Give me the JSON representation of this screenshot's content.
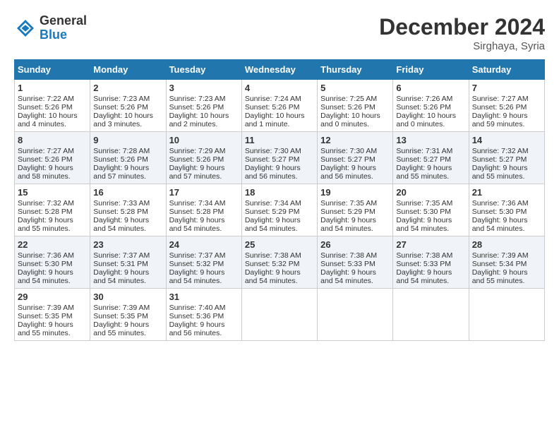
{
  "header": {
    "logo_general": "General",
    "logo_blue": "Blue",
    "month_title": "December 2024",
    "location": "Sirghaya, Syria"
  },
  "weekdays": [
    "Sunday",
    "Monday",
    "Tuesday",
    "Wednesday",
    "Thursday",
    "Friday",
    "Saturday"
  ],
  "weeks": [
    [
      {
        "day": "1",
        "sunrise": "Sunrise: 7:22 AM",
        "sunset": "Sunset: 5:26 PM",
        "daylight": "Daylight: 10 hours and 4 minutes."
      },
      {
        "day": "2",
        "sunrise": "Sunrise: 7:23 AM",
        "sunset": "Sunset: 5:26 PM",
        "daylight": "Daylight: 10 hours and 3 minutes."
      },
      {
        "day": "3",
        "sunrise": "Sunrise: 7:23 AM",
        "sunset": "Sunset: 5:26 PM",
        "daylight": "Daylight: 10 hours and 2 minutes."
      },
      {
        "day": "4",
        "sunrise": "Sunrise: 7:24 AM",
        "sunset": "Sunset: 5:26 PM",
        "daylight": "Daylight: 10 hours and 1 minute."
      },
      {
        "day": "5",
        "sunrise": "Sunrise: 7:25 AM",
        "sunset": "Sunset: 5:26 PM",
        "daylight": "Daylight: 10 hours and 0 minutes."
      },
      {
        "day": "6",
        "sunrise": "Sunrise: 7:26 AM",
        "sunset": "Sunset: 5:26 PM",
        "daylight": "Daylight: 10 hours and 0 minutes."
      },
      {
        "day": "7",
        "sunrise": "Sunrise: 7:27 AM",
        "sunset": "Sunset: 5:26 PM",
        "daylight": "Daylight: 9 hours and 59 minutes."
      }
    ],
    [
      {
        "day": "8",
        "sunrise": "Sunrise: 7:27 AM",
        "sunset": "Sunset: 5:26 PM",
        "daylight": "Daylight: 9 hours and 58 minutes."
      },
      {
        "day": "9",
        "sunrise": "Sunrise: 7:28 AM",
        "sunset": "Sunset: 5:26 PM",
        "daylight": "Daylight: 9 hours and 57 minutes."
      },
      {
        "day": "10",
        "sunrise": "Sunrise: 7:29 AM",
        "sunset": "Sunset: 5:26 PM",
        "daylight": "Daylight: 9 hours and 57 minutes."
      },
      {
        "day": "11",
        "sunrise": "Sunrise: 7:30 AM",
        "sunset": "Sunset: 5:27 PM",
        "daylight": "Daylight: 9 hours and 56 minutes."
      },
      {
        "day": "12",
        "sunrise": "Sunrise: 7:30 AM",
        "sunset": "Sunset: 5:27 PM",
        "daylight": "Daylight: 9 hours and 56 minutes."
      },
      {
        "day": "13",
        "sunrise": "Sunrise: 7:31 AM",
        "sunset": "Sunset: 5:27 PM",
        "daylight": "Daylight: 9 hours and 55 minutes."
      },
      {
        "day": "14",
        "sunrise": "Sunrise: 7:32 AM",
        "sunset": "Sunset: 5:27 PM",
        "daylight": "Daylight: 9 hours and 55 minutes."
      }
    ],
    [
      {
        "day": "15",
        "sunrise": "Sunrise: 7:32 AM",
        "sunset": "Sunset: 5:28 PM",
        "daylight": "Daylight: 9 hours and 55 minutes."
      },
      {
        "day": "16",
        "sunrise": "Sunrise: 7:33 AM",
        "sunset": "Sunset: 5:28 PM",
        "daylight": "Daylight: 9 hours and 54 minutes."
      },
      {
        "day": "17",
        "sunrise": "Sunrise: 7:34 AM",
        "sunset": "Sunset: 5:28 PM",
        "daylight": "Daylight: 9 hours and 54 minutes."
      },
      {
        "day": "18",
        "sunrise": "Sunrise: 7:34 AM",
        "sunset": "Sunset: 5:29 PM",
        "daylight": "Daylight: 9 hours and 54 minutes."
      },
      {
        "day": "19",
        "sunrise": "Sunrise: 7:35 AM",
        "sunset": "Sunset: 5:29 PM",
        "daylight": "Daylight: 9 hours and 54 minutes."
      },
      {
        "day": "20",
        "sunrise": "Sunrise: 7:35 AM",
        "sunset": "Sunset: 5:30 PM",
        "daylight": "Daylight: 9 hours and 54 minutes."
      },
      {
        "day": "21",
        "sunrise": "Sunrise: 7:36 AM",
        "sunset": "Sunset: 5:30 PM",
        "daylight": "Daylight: 9 hours and 54 minutes."
      }
    ],
    [
      {
        "day": "22",
        "sunrise": "Sunrise: 7:36 AM",
        "sunset": "Sunset: 5:30 PM",
        "daylight": "Daylight: 9 hours and 54 minutes."
      },
      {
        "day": "23",
        "sunrise": "Sunrise: 7:37 AM",
        "sunset": "Sunset: 5:31 PM",
        "daylight": "Daylight: 9 hours and 54 minutes."
      },
      {
        "day": "24",
        "sunrise": "Sunrise: 7:37 AM",
        "sunset": "Sunset: 5:32 PM",
        "daylight": "Daylight: 9 hours and 54 minutes."
      },
      {
        "day": "25",
        "sunrise": "Sunrise: 7:38 AM",
        "sunset": "Sunset: 5:32 PM",
        "daylight": "Daylight: 9 hours and 54 minutes."
      },
      {
        "day": "26",
        "sunrise": "Sunrise: 7:38 AM",
        "sunset": "Sunset: 5:33 PM",
        "daylight": "Daylight: 9 hours and 54 minutes."
      },
      {
        "day": "27",
        "sunrise": "Sunrise: 7:38 AM",
        "sunset": "Sunset: 5:33 PM",
        "daylight": "Daylight: 9 hours and 54 minutes."
      },
      {
        "day": "28",
        "sunrise": "Sunrise: 7:39 AM",
        "sunset": "Sunset: 5:34 PM",
        "daylight": "Daylight: 9 hours and 55 minutes."
      }
    ],
    [
      {
        "day": "29",
        "sunrise": "Sunrise: 7:39 AM",
        "sunset": "Sunset: 5:35 PM",
        "daylight": "Daylight: 9 hours and 55 minutes."
      },
      {
        "day": "30",
        "sunrise": "Sunrise: 7:39 AM",
        "sunset": "Sunset: 5:35 PM",
        "daylight": "Daylight: 9 hours and 55 minutes."
      },
      {
        "day": "31",
        "sunrise": "Sunrise: 7:40 AM",
        "sunset": "Sunset: 5:36 PM",
        "daylight": "Daylight: 9 hours and 56 minutes."
      },
      null,
      null,
      null,
      null
    ]
  ]
}
